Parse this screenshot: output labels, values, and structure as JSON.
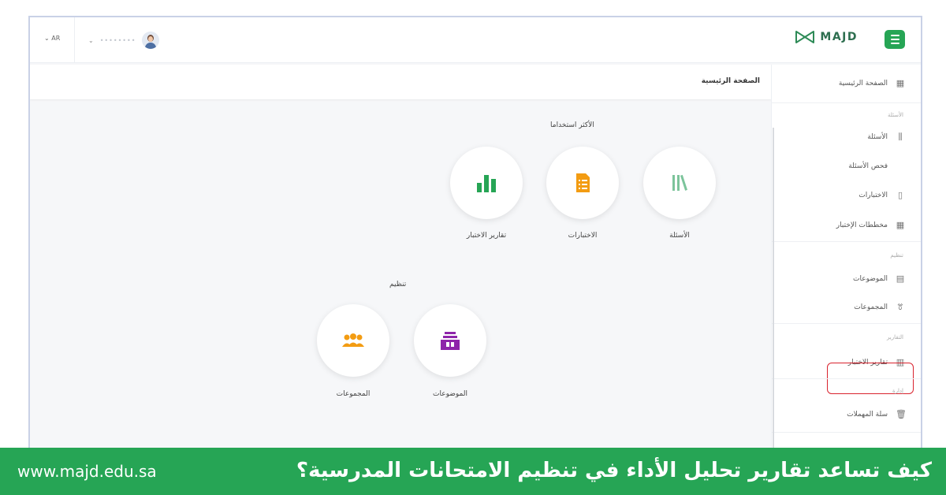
{
  "topbar": {
    "lang": "AR",
    "user_name": "••••••••",
    "logo_text": "MAJD"
  },
  "breadcrumb": "الصفحة الرئيسية",
  "sidebar": {
    "home": "الصفحة الرئيسية",
    "section_questions": "الأسئلة",
    "questions": "الأسئلة",
    "question_review": "فحص الأسئلة",
    "exams": "الاختبارات",
    "exam_plans": "مخططات الإختبار",
    "section_organize": "تنظيم",
    "topics": "الموضوعات",
    "groups": "المجموعات",
    "section_reports": "التقارير",
    "exam_reports": "تقارير الاختبار",
    "section_admin": "إدارة",
    "recycle_bin": "سلة المهملات"
  },
  "main": {
    "most_used_title": "الأكثر استخداما",
    "most_used": [
      {
        "label": "الأسئلة",
        "icon": "books-icon",
        "color": "#4caf78"
      },
      {
        "label": "الاختبارات",
        "icon": "document-icon",
        "color": "#f39c12"
      },
      {
        "label": "تقارير الاختبار",
        "icon": "bar-chart-icon",
        "color": "#26a555"
      }
    ],
    "organize_title": "تنظيم",
    "organize": [
      {
        "label": "الموضوعات",
        "icon": "archive-icon",
        "color": "#8e24aa"
      },
      {
        "label": "المجموعات",
        "icon": "users-icon",
        "color": "#f39c12"
      }
    ]
  },
  "footer": {
    "site": "www.majd.edu.sa",
    "headline": "كيف تساعد تقارير تحليل الأداء في تنظيم الامتحانات المدرسية؟"
  },
  "colors": {
    "brand_green": "#26a555",
    "highlight_red": "#d9232e"
  }
}
